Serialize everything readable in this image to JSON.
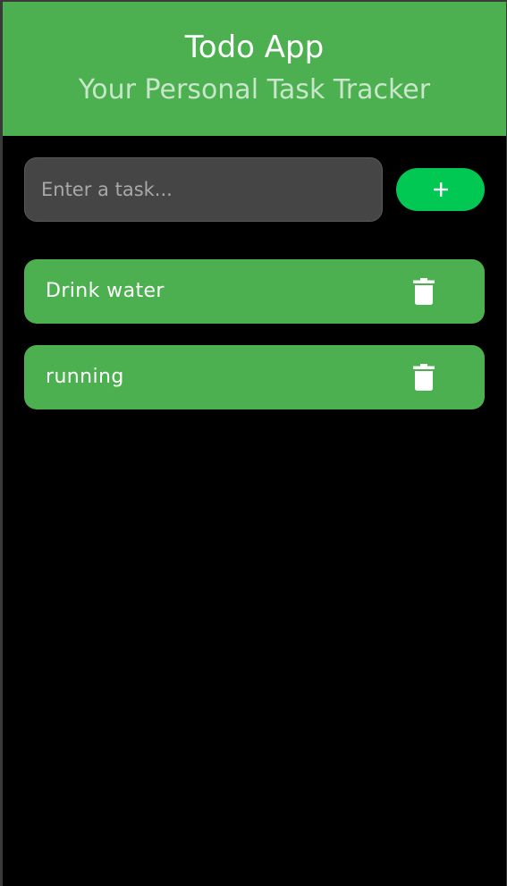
{
  "header": {
    "title": "Todo App",
    "subtitle": "Your Personal Task Tracker"
  },
  "input": {
    "placeholder": "Enter a task...",
    "value": ""
  },
  "add_button": {
    "icon": "plus-icon"
  },
  "tasks": [
    {
      "label": "Drink water",
      "icon": "trash-icon"
    },
    {
      "label": "running",
      "icon": "trash-icon"
    }
  ],
  "colors": {
    "header_bg": "#4caf50",
    "subtitle": "#c8e6c9",
    "add_button": "#00c853",
    "task_bg": "#4caf50",
    "background": "#000000",
    "input_bg": "#454545"
  }
}
